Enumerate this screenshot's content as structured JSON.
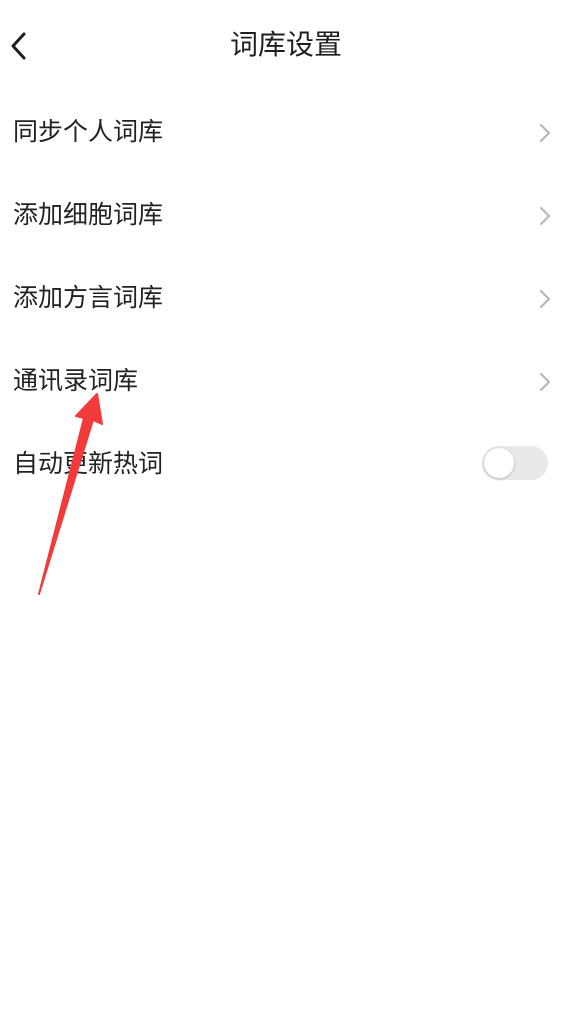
{
  "header": {
    "back_icon": "chevron-left-icon",
    "title": "词库设置"
  },
  "settings": {
    "items": [
      {
        "label": "同步个人词库",
        "control": "chevron-right-icon"
      },
      {
        "label": "添加细胞词库",
        "control": "chevron-right-icon"
      },
      {
        "label": "添加方言词库",
        "control": "chevron-right-icon"
      },
      {
        "label": "通讯录词库",
        "control": "chevron-right-icon"
      },
      {
        "label": "自动更新热词",
        "control": "toggle-switch",
        "toggle_on": false
      }
    ]
  },
  "annotation": {
    "arrow_color": "#f23a3a",
    "arrow_target": "通讯录词库"
  },
  "colors": {
    "background": "#ffffff",
    "text": "#222222",
    "chevron": "#b5b5b5",
    "toggle_off_track": "#e9e9eb"
  }
}
